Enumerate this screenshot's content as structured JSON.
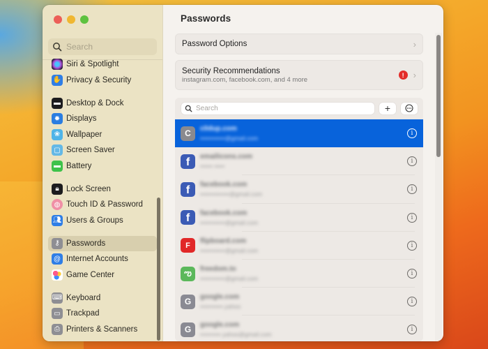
{
  "window": {
    "title": "Passwords"
  },
  "sidebar": {
    "search_placeholder": "Search",
    "groups": [
      [
        {
          "label": "Siri & Spotlight",
          "icon": "siri-icon",
          "color": "#7a3fb8"
        },
        {
          "label": "Privacy & Security",
          "icon": "hand-icon",
          "color": "#2f7ee6"
        }
      ],
      [
        {
          "label": "Desktop & Dock",
          "icon": "dock-icon",
          "color": "#1c1c1e"
        },
        {
          "label": "Displays",
          "icon": "sun-icon",
          "color": "#2a7de1"
        },
        {
          "label": "Wallpaper",
          "icon": "flower-icon",
          "color": "#4fb4e8"
        },
        {
          "label": "Screen Saver",
          "icon": "screen-saver-icon",
          "color": "#64b8e6"
        },
        {
          "label": "Battery",
          "icon": "battery-icon",
          "color": "#3ec24a"
        }
      ],
      [
        {
          "label": "Lock Screen",
          "icon": "lock-icon",
          "color": "#1c1c1e"
        },
        {
          "label": "Touch ID & Password",
          "icon": "fingerprint-icon",
          "color": "#f08fa6"
        },
        {
          "label": "Users & Groups",
          "icon": "users-icon",
          "color": "#2f7ee6"
        }
      ],
      [
        {
          "label": "Passwords",
          "icon": "key-icon",
          "color": "#8e8e93",
          "selected": true
        },
        {
          "label": "Internet Accounts",
          "icon": "at-icon",
          "color": "#2f7ee6"
        },
        {
          "label": "Game Center",
          "icon": "game-center-icon",
          "color": "#ffffff"
        }
      ],
      [
        {
          "label": "Keyboard",
          "icon": "keyboard-icon",
          "color": "#8e8e93"
        },
        {
          "label": "Trackpad",
          "icon": "trackpad-icon",
          "color": "#8e8e93"
        },
        {
          "label": "Printers & Scanners",
          "icon": "printer-icon",
          "color": "#8e8e93"
        }
      ]
    ]
  },
  "main": {
    "password_options": {
      "label": "Password Options"
    },
    "security_recommendations": {
      "label": "Security Recommendations",
      "subtitle": "instagram.com, facebook.com, and 4 more",
      "badge": "!"
    },
    "list_search_placeholder": "Search",
    "add_label": "+",
    "more_label": "⋯",
    "entries": [
      {
        "site": "c0dup.com",
        "user": "••••••••••••@gmail.com",
        "icon_letter": "C",
        "icon_type": "letter",
        "icon_color": "#8a8a8f",
        "selected": true
      },
      {
        "site": "emailicons.com",
        "user": "•••••• •••••",
        "icon_letter": "f",
        "icon_type": "facebook",
        "icon_color": "#3b5bb5"
      },
      {
        "site": "facebook.com",
        "user": "••••••••••••••@gmail.com",
        "icon_letter": "f",
        "icon_type": "facebook",
        "icon_color": "#3b5bb5"
      },
      {
        "site": "facebook.com",
        "user": "••••••••••••@gmail.com",
        "icon_letter": "f",
        "icon_type": "facebook",
        "icon_color": "#3b5bb5"
      },
      {
        "site": "flipboard.com",
        "user": "••••••••••••@gmail.com",
        "icon_letter": "F",
        "icon_type": "flipboard",
        "icon_color": "#e12828"
      },
      {
        "site": "freedom.to",
        "user": "••••••••••••@gmail.com",
        "icon_letter": "ఌ",
        "icon_type": "butterfly",
        "icon_color": "#5bb85b"
      },
      {
        "site": "google.com",
        "user": "•••••••••••.yahoo",
        "icon_letter": "G",
        "icon_type": "letter",
        "icon_color": "#8a8a93"
      },
      {
        "site": "google.com",
        "user": "••••••••••.yahoo@gmail.com",
        "icon_letter": "G",
        "icon_type": "letter",
        "icon_color": "#8a8a93"
      }
    ]
  }
}
